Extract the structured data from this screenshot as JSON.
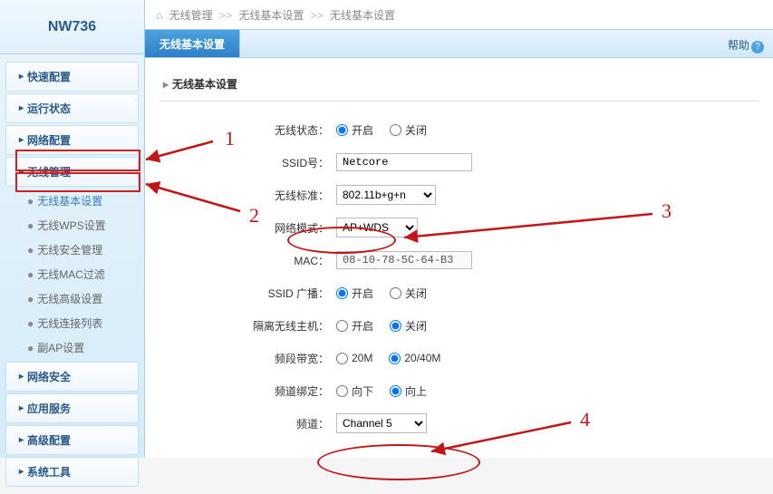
{
  "logo": "NW736",
  "nav": {
    "quick": "快速配置",
    "status": "运行状态",
    "netcfg": "网络配置",
    "wlan": "无线管理",
    "wlan_sub": {
      "basic": "无线基本设置",
      "wps": "无线WPS设置",
      "security": "无线安全管理",
      "mac": "无线MAC过滤",
      "advanced": "无线高级设置",
      "clients": "无线连接列表",
      "subap": "副AP设置"
    },
    "netsec": "网络安全",
    "appserv": "应用服务",
    "advcfg": "高级配置",
    "systools": "系统工具"
  },
  "breadcrumb": {
    "a": "无线管理",
    "b": "无线基本设置",
    "c": "无线基本设置"
  },
  "tab": "无线基本设置",
  "help": "帮助",
  "panel_title": "无线基本设置",
  "form": {
    "state_label": "无线状态：",
    "on": "开启",
    "off": "关闭",
    "ssid_label": "SSID号：",
    "ssid_value": "Netcore",
    "std_label": "无线标准：",
    "std_value": "802.11b+g+n",
    "mode_label": "网络模式：",
    "mode_value": "AP+WDS",
    "mac_label": "MAC：",
    "mac_value": "08-10-78-5C-64-B3",
    "bcast_label": "SSID 广播：",
    "isolate_label": "隔离无线主机：",
    "bw_label": "频段带宽：",
    "bw_20": "20M",
    "bw_2040": "20/40M",
    "bind_label": "频道绑定：",
    "bind_down": "向下",
    "bind_up": "向上",
    "chan_label": "频道：",
    "chan_value": "Channel 5"
  },
  "anno": {
    "l1": "1",
    "l2": "2",
    "l3": "3",
    "l4": "4"
  }
}
